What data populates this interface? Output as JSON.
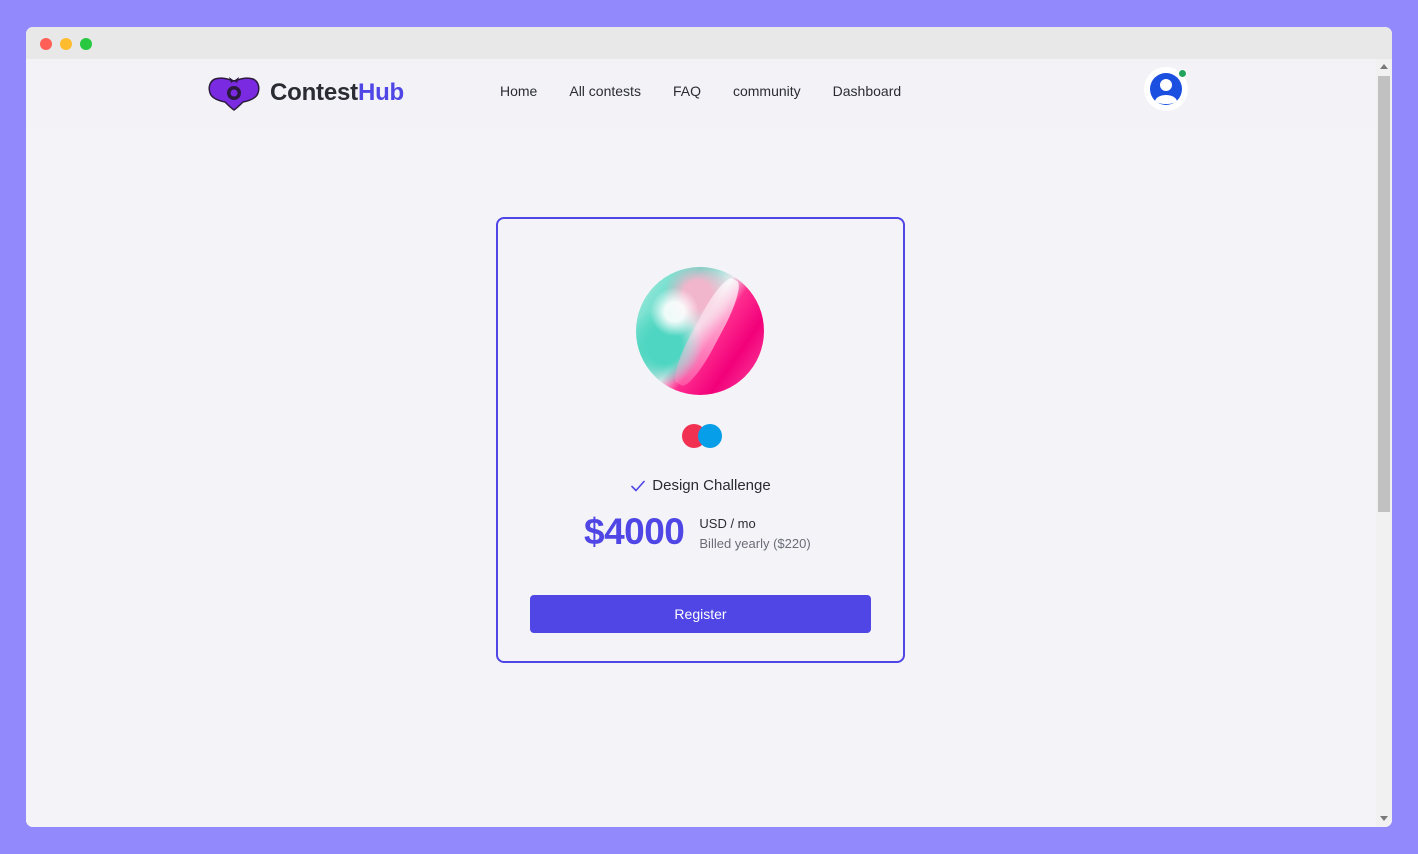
{
  "window": {
    "controls": [
      "close",
      "minimize",
      "maximize"
    ]
  },
  "navbar": {
    "brand": {
      "name_part1": "Contest",
      "name_part2": "Hub",
      "logo_icon": "bat-logo-icon",
      "accent_color": "#4f46e5"
    },
    "links": [
      {
        "label": "Home"
      },
      {
        "label": "All contests"
      },
      {
        "label": "FAQ"
      },
      {
        "label": "community"
      },
      {
        "label": "Dashboard"
      }
    ],
    "user": {
      "icon": "user-avatar-icon",
      "status": "online"
    }
  },
  "contest_card": {
    "image_icon": "fluid-art-contest-image",
    "brand_icon": "dual-circle-logo-icon",
    "feature": {
      "icon": "check-icon",
      "label": "Design Challenge"
    },
    "price": "$4000",
    "unit": "USD / mo",
    "billing": "Billed yearly ($220)",
    "button_label": "Register"
  },
  "colors": {
    "primary": "#4f46e5",
    "background": "#9289fd",
    "page": "#f4f4f8"
  }
}
